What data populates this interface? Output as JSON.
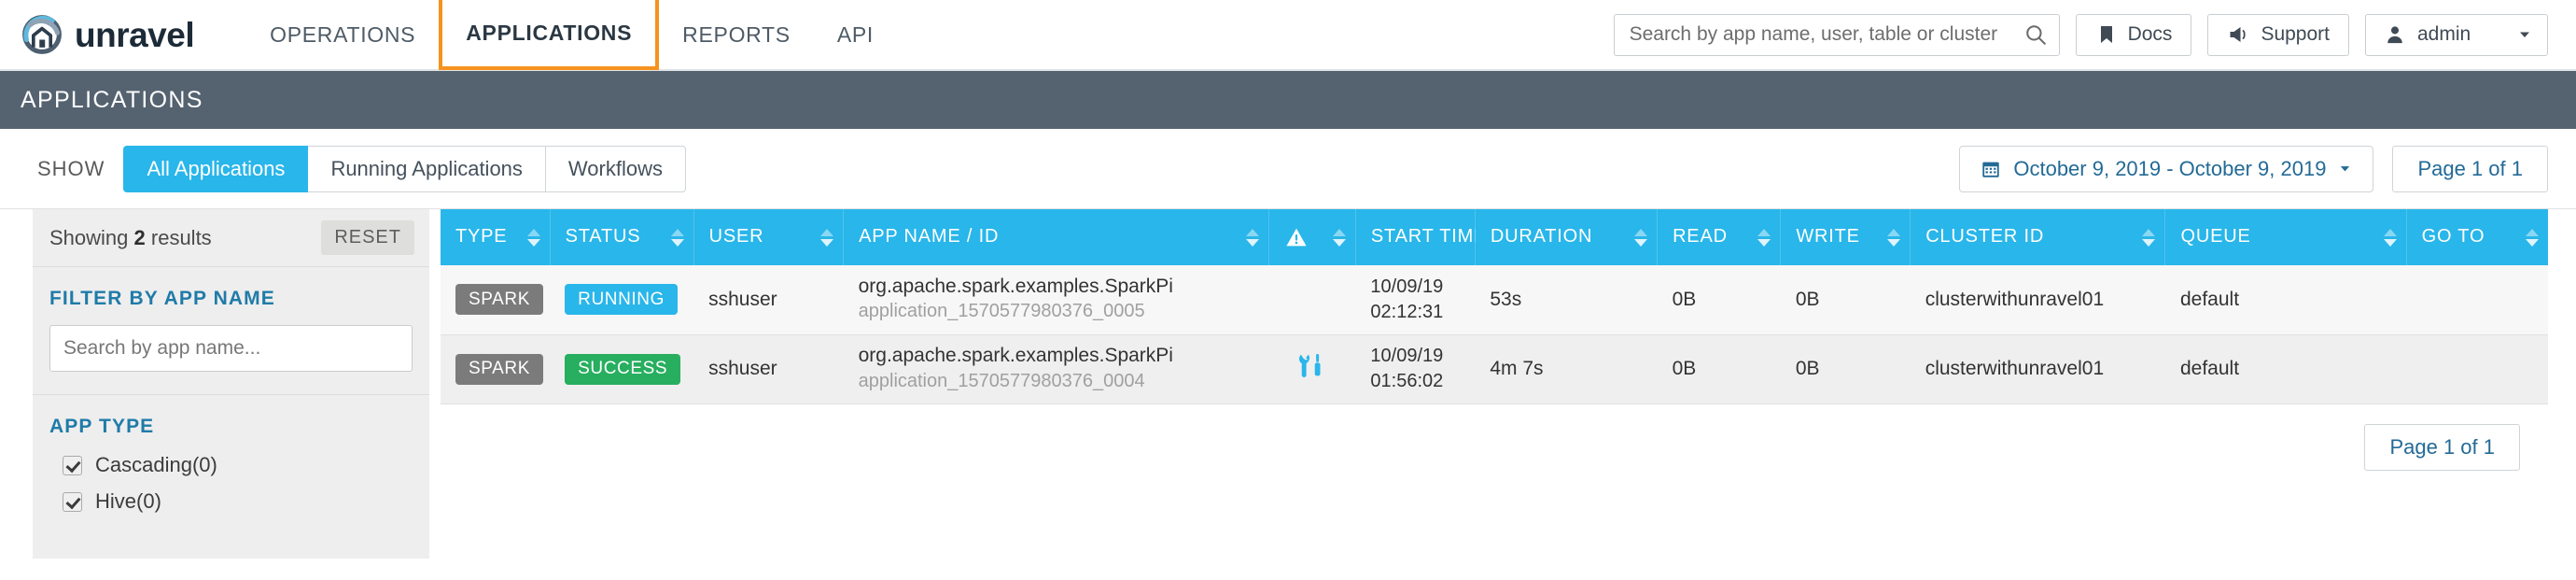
{
  "brand": {
    "name": "unravel"
  },
  "nav": {
    "items": [
      {
        "label": "OPERATIONS",
        "active": false
      },
      {
        "label": "APPLICATIONS",
        "active": true
      },
      {
        "label": "REPORTS",
        "active": false
      },
      {
        "label": "API",
        "active": false
      }
    ],
    "search": {
      "value": "",
      "placeholder": "Search by app name, user, table or cluster"
    },
    "docs_label": "Docs",
    "support_label": "Support",
    "user_label": "admin"
  },
  "page": {
    "title": "APPLICATIONS"
  },
  "toolbar": {
    "show_label": "SHOW",
    "segments": [
      {
        "label": "All Applications",
        "active": true
      },
      {
        "label": "Running Applications",
        "active": false
      },
      {
        "label": "Workflows",
        "active": false
      }
    ],
    "date_range": "October 9, 2019 - October 9, 2019",
    "page_indicator": "Page 1 of 1"
  },
  "sidebar": {
    "showing_prefix": "Showing ",
    "showing_count": "2",
    "showing_suffix": " results",
    "reset_label": "RESET",
    "filter_app_name": {
      "title": "FILTER BY APP NAME",
      "value": "",
      "placeholder": "Search by app name..."
    },
    "app_type": {
      "title": "APP TYPE",
      "options": [
        {
          "label": "Cascading(0)",
          "checked": true
        },
        {
          "label": "Hive(0)",
          "checked": true
        }
      ]
    }
  },
  "table": {
    "columns": [
      {
        "key": "type",
        "label": "TYPE"
      },
      {
        "key": "status",
        "label": "STATUS"
      },
      {
        "key": "user",
        "label": "USER"
      },
      {
        "key": "app",
        "label": "APP NAME / ID"
      },
      {
        "key": "alert",
        "label": "",
        "icon": "warning-triangle-icon"
      },
      {
        "key": "start_time",
        "label": "START TIME"
      },
      {
        "key": "duration",
        "label": "DURATION"
      },
      {
        "key": "read",
        "label": "READ"
      },
      {
        "key": "write",
        "label": "WRITE"
      },
      {
        "key": "cluster_id",
        "label": "CLUSTER ID"
      },
      {
        "key": "queue",
        "label": "QUEUE"
      },
      {
        "key": "goto",
        "label": "GO TO"
      }
    ],
    "rows": [
      {
        "type": "SPARK",
        "status": "RUNNING",
        "status_kind": "running",
        "user": "sshuser",
        "app_name": "org.apache.spark.examples.SparkPi",
        "app_id": "application_1570577980376_0005",
        "alert_icon": "",
        "start_date": "10/09/19",
        "start_clock": "02:12:31",
        "duration": "53s",
        "read": "0B",
        "write": "0B",
        "cluster_id": "clusterwithunravel01",
        "queue": "default",
        "goto": ""
      },
      {
        "type": "SPARK",
        "status": "SUCCESS",
        "status_kind": "success",
        "user": "sshuser",
        "app_name": "org.apache.spark.examples.SparkPi",
        "app_id": "application_1570577980376_0004",
        "alert_icon": "tools-icon",
        "start_date": "10/09/19",
        "start_clock": "01:56:02",
        "duration": "4m 7s",
        "read": "0B",
        "write": "0B",
        "cluster_id": "clusterwithunravel01",
        "queue": "default",
        "goto": ""
      }
    ]
  },
  "footer": {
    "page_indicator": "Page 1 of 1"
  },
  "colors": {
    "accent_blue": "#29b6ea",
    "accent_orange": "#f5931e",
    "pagebar": "#556270",
    "success_green": "#27ae5f",
    "type_gray": "#7b7b7b",
    "link_blue": "#236a96",
    "section_title": "#1f7ba8"
  }
}
